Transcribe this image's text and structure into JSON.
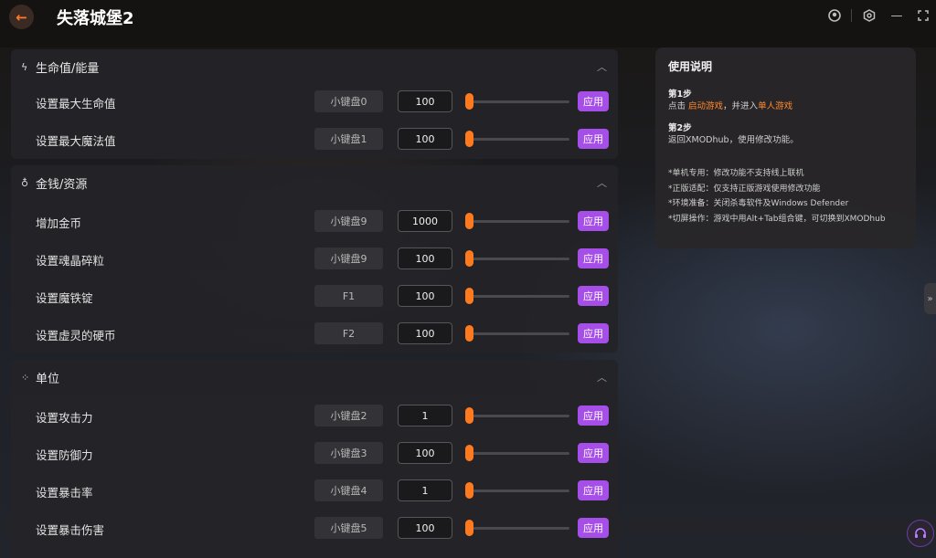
{
  "window": {
    "title": "失落城堡2",
    "back_icon": "arrow-left-icon",
    "accent": "#ff7a1e",
    "apply_color": "#a64fe8"
  },
  "sections": [
    {
      "title": "生命值/能量",
      "icon": "bolt-icon",
      "rows": [
        {
          "label": "设置最大生命值",
          "hotkey": "小键盘0",
          "value": "100",
          "apply": "应用"
        },
        {
          "label": "设置最大魔法值",
          "hotkey": "小键盘1",
          "value": "100",
          "apply": "应用"
        }
      ]
    },
    {
      "title": "金钱/资源",
      "icon": "money-bag-icon",
      "rows": [
        {
          "label": "增加金币",
          "hotkey": "小键盘9",
          "value": "1000",
          "apply": "应用"
        },
        {
          "label": "设置魂晶碎粒",
          "hotkey": "小键盘9",
          "value": "100",
          "apply": "应用"
        },
        {
          "label": "设置魔铁锭",
          "hotkey": "F1",
          "value": "100",
          "apply": "应用"
        },
        {
          "label": "设置虚灵的硬币",
          "hotkey": "F2",
          "value": "100",
          "apply": "应用"
        }
      ]
    },
    {
      "title": "单位",
      "icon": "nodes-icon",
      "rows": [
        {
          "label": "设置攻击力",
          "hotkey": "小键盘2",
          "value": "1",
          "apply": "应用"
        },
        {
          "label": "设置防御力",
          "hotkey": "小键盘3",
          "value": "100",
          "apply": "应用"
        },
        {
          "label": "设置暴击率",
          "hotkey": "小键盘4",
          "value": "1",
          "apply": "应用"
        },
        {
          "label": "设置暴击伤害",
          "hotkey": "小键盘5",
          "value": "100",
          "apply": "应用"
        }
      ]
    }
  ],
  "help": {
    "title": "使用说明",
    "step1_title": "第1步",
    "step1_prefix": "点击 ",
    "step1_link1": "启动游戏",
    "step1_mid": "，并进入",
    "step1_link2": "单人游戏",
    "step2_title": "第2步",
    "step2_text": "返回XMODhub，使用修改功能。",
    "notes": [
      "*单机专用：修改功能不支持线上联机",
      "*正版适配：仅支持正版游戏使用修改功能",
      "*环境准备：关闭杀毒软件及Windows Defender",
      "*切屏操作：游戏中用Alt+Tab组合键，可切换到XMODhub"
    ]
  }
}
